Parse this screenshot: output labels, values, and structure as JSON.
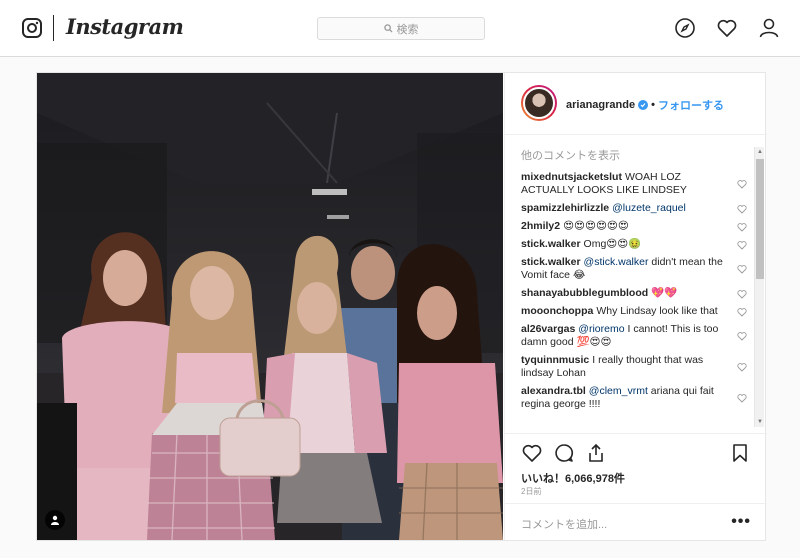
{
  "header": {
    "logo_text": "Instagram",
    "search_placeholder": "検索"
  },
  "post": {
    "username": "arianagrande",
    "dot": "•",
    "follow_label": "フォローする",
    "load_more": "他のコメントを表示",
    "comments": [
      {
        "user": "mixednutsjacketslut",
        "text": "WOAH LOZ ACTUALLY LOOKS LIKE LINDSEY"
      },
      {
        "user": "spamizzlehirlizzle",
        "mention": "@luzete_raquel",
        "text": ""
      },
      {
        "user": "2hmily2",
        "text": "😍😍😍😍😍😍"
      },
      {
        "user": "stick.walker",
        "text": "Omg😍😍🤢"
      },
      {
        "user": "stick.walker",
        "mention": "@stick.walker",
        "text": "didn't mean the Vomit face 😂"
      },
      {
        "user": "shanayabubblegumblood",
        "text": "💖💖"
      },
      {
        "user": "mooonchoppa",
        "text": "Why Lindsay look like that"
      },
      {
        "user": "al26vargas",
        "mention": "@rioremo",
        "text": "I cannot! This is too damn good 💯😍😍"
      },
      {
        "user": "tyquinnmusic",
        "text": "I really thought that was lindsay Lohan"
      },
      {
        "user": "alexandra.tbl",
        "mention": "@clem_vrmt",
        "text": "ariana qui fait regina george !!!!"
      }
    ],
    "likes": "いいね！6,066,978件",
    "date": "2日前",
    "add_comment_placeholder": "コメントを追加...",
    "more_options": "•••"
  }
}
